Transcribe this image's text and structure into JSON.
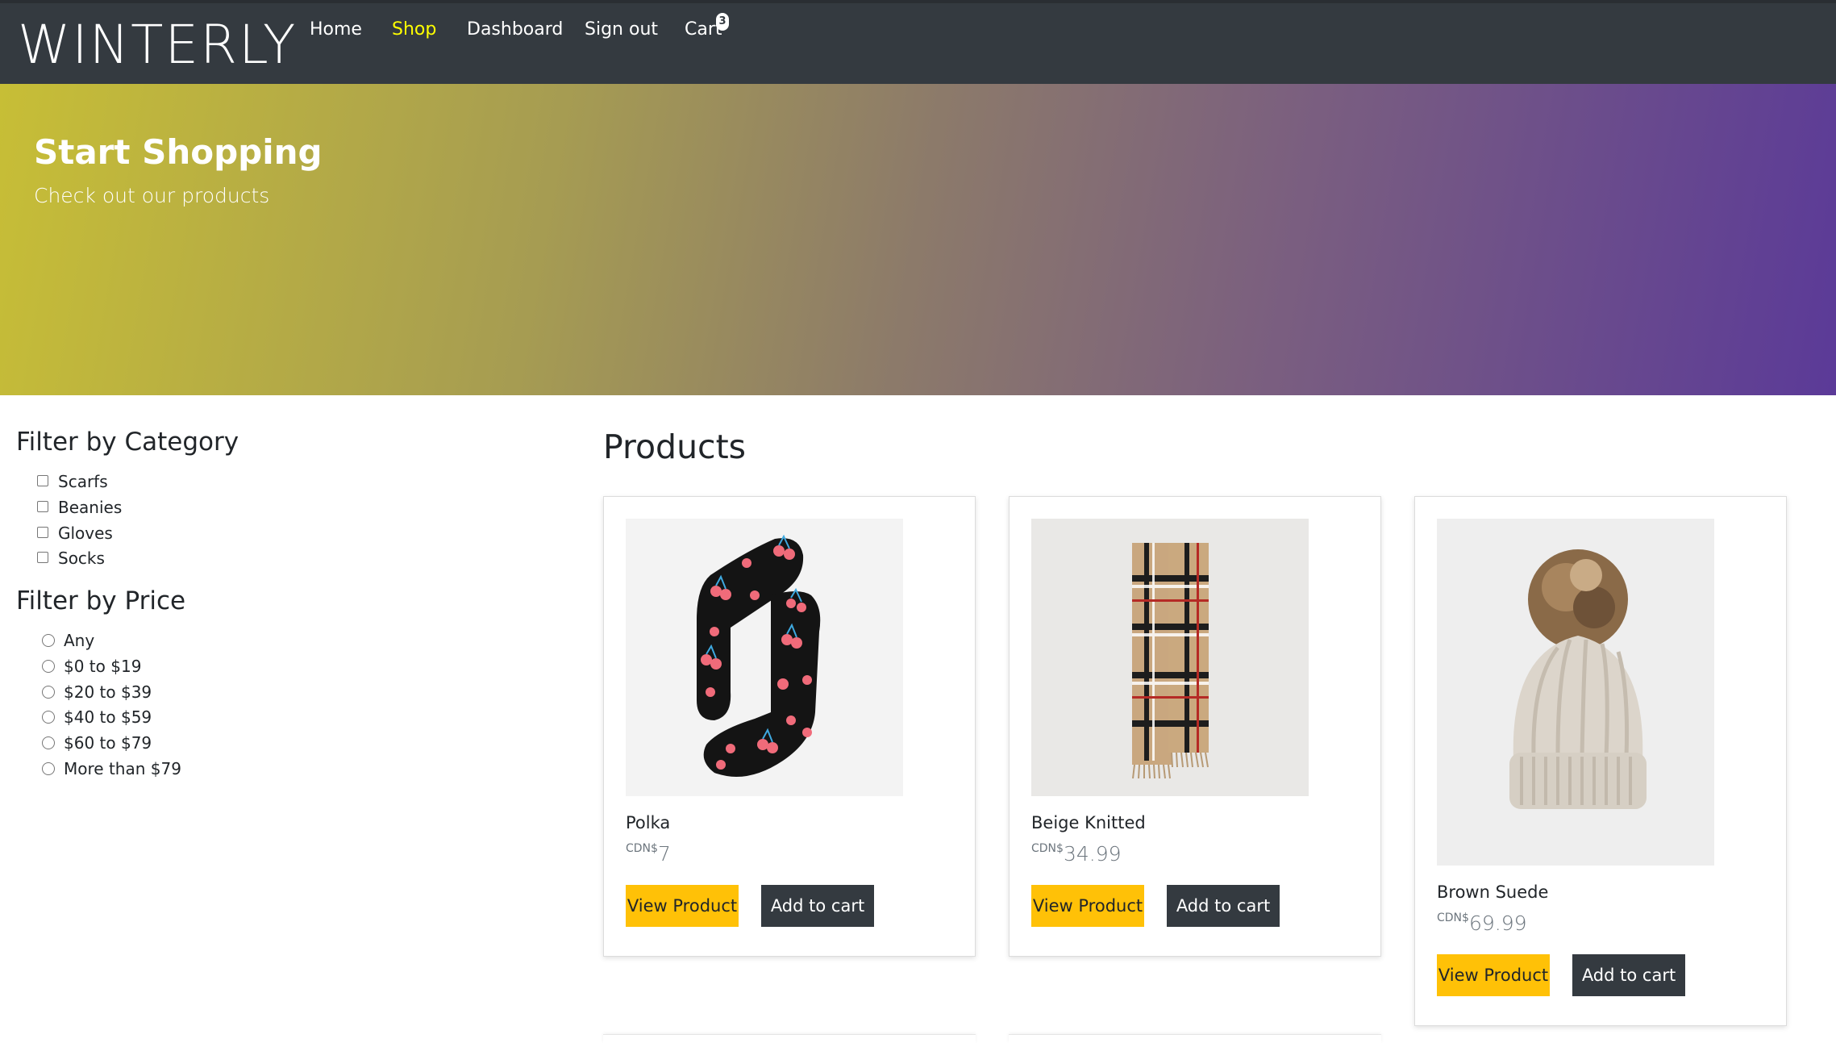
{
  "navbar": {
    "brand": "WINTERLY",
    "links": {
      "home": "Home",
      "shop": "Shop",
      "dashboard": "Dashboard",
      "signout": "Sign out",
      "cart": "Cart"
    },
    "cart_count": "3",
    "active_link": "Shop",
    "active_color": "#ffff00"
  },
  "hero": {
    "title": "Start Shopping",
    "subtitle": "Check out our products"
  },
  "filters": {
    "category_heading": "Filter by Category",
    "categories": [
      "Scarfs",
      "Beanies",
      "Gloves",
      "Socks"
    ],
    "price_heading": "Filter by Price",
    "prices": [
      "Any",
      "$0 to $19",
      "$20 to $39",
      "$40 to $59",
      "$60 to $79",
      "More than $79"
    ]
  },
  "products": {
    "title": "Products",
    "items": [
      {
        "name": "Polka",
        "currency": "CDN$",
        "price": "7",
        "view_label": "View Product",
        "cart_label": "Add to cart",
        "image_icon": "cherry-socks-image"
      },
      {
        "name": "Beige Knitted",
        "currency": "CDN$",
        "price": "34.99",
        "view_label": "View Product",
        "cart_label": "Add to cart",
        "image_icon": "plaid-scarf-image"
      },
      {
        "name": "Brown Suede",
        "currency": "CDN$",
        "price": "69.99",
        "view_label": "View Product",
        "cart_label": "Add to cart",
        "image_icon": "pompom-beanie-image"
      }
    ]
  },
  "colors": {
    "navbar": "#343a40",
    "view_button": "#ffc107",
    "cart_button": "#343a40"
  }
}
